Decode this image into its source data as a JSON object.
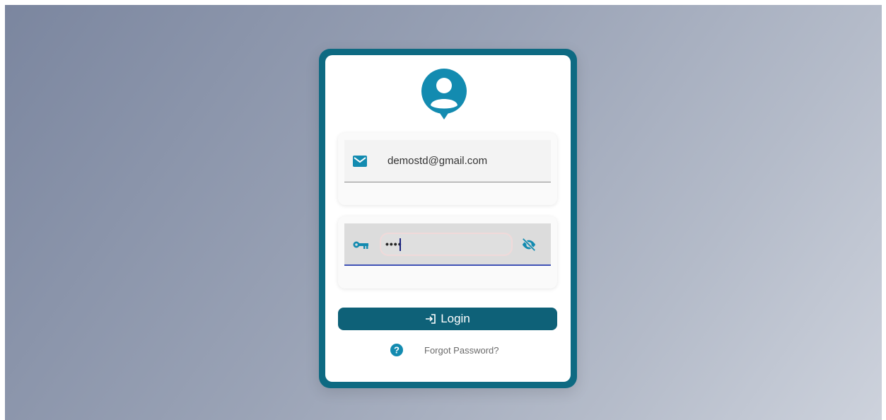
{
  "login_form": {
    "email": {
      "value": "demostd@gmail.com",
      "icon": "mail-icon"
    },
    "password": {
      "masked_value": "••••",
      "icon": "key-icon",
      "visibility_icon": "eye-off-icon"
    },
    "login_button": {
      "label": "Login",
      "icon": "login-icon"
    },
    "forgot_password": {
      "label": "Forgot Password?",
      "icon": "help-circle-icon"
    },
    "avatar_icon": "user-pin-icon"
  },
  "colors": {
    "primary": "#0e6a82",
    "button": "#0e6178",
    "icon": "#138bb0",
    "focus_underline": "#3f51b5"
  }
}
